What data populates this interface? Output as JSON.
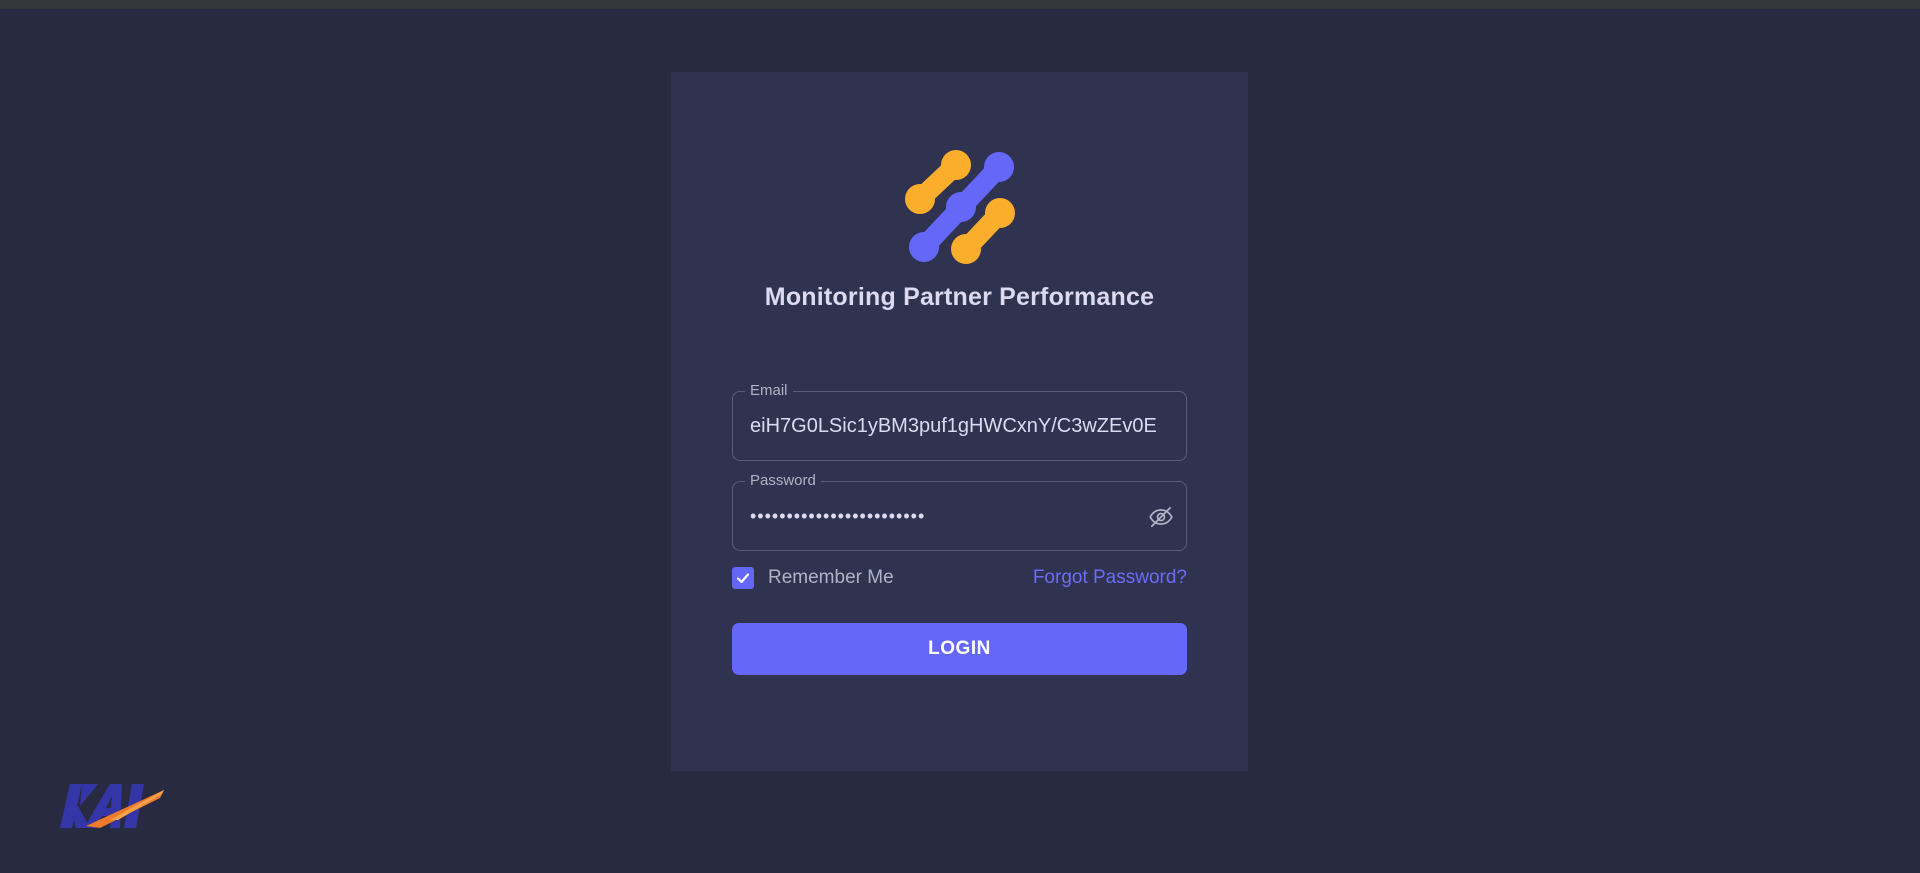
{
  "app": {
    "title": "Monitoring Partner Performance"
  },
  "form": {
    "email_label": "Email",
    "email_value": "eiH7G0LSic1yBM3puf1gHWCxnY/C3wZEv0E",
    "password_label": "Password",
    "password_value": "••••••••••••••••••••••••",
    "password_toggle_icon": "eye-off-icon",
    "remember_label": "Remember Me",
    "remember_checked": true,
    "forgot_label": "Forgot Password?",
    "login_label": "LOGIN"
  },
  "brand": {
    "logo_icon": "molecule-logo-icon",
    "company_logo": "kai-logo",
    "company_logo_text": "KAI",
    "colors": {
      "accent": "#6467f8",
      "orange": "#fbae2b",
      "background": "#282a41",
      "card": "#30334f"
    }
  }
}
